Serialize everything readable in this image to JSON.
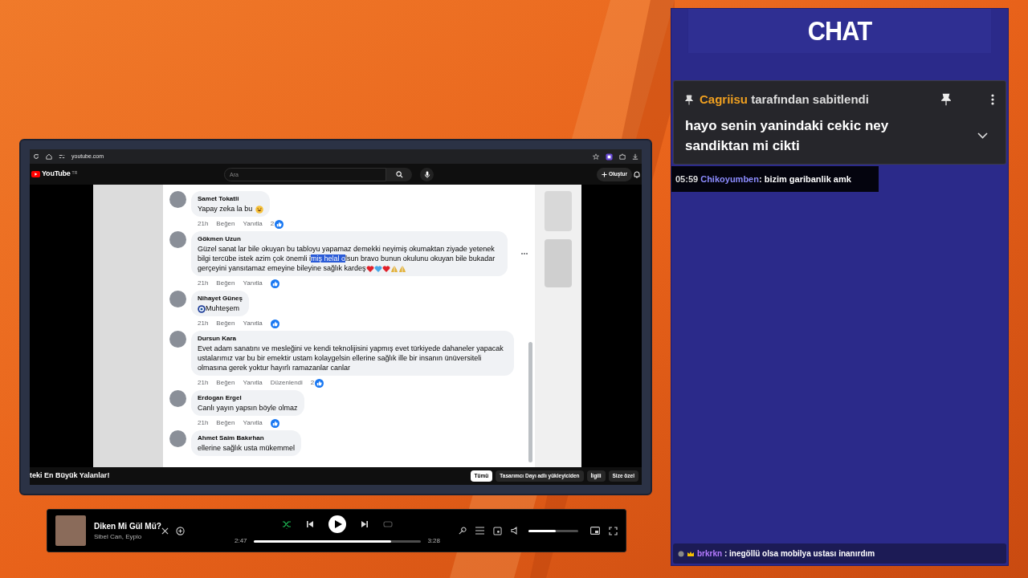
{
  "browser": {
    "url": "youtube.com",
    "youtube": {
      "logo": "YouTube",
      "region": "TR",
      "search_placeholder": "Ara",
      "create": "Oluştur"
    }
  },
  "comments": [
    {
      "author": "Samet Tokatli",
      "segments": [
        {
          "text": "Yapay zeka la bu",
          "selected": false
        }
      ],
      "emojis": [
        {
          "kind": "laugh"
        }
      ],
      "time": "21h",
      "like": "Beğen",
      "reply": "Yanıtla",
      "likes": "2"
    },
    {
      "author": "Gökmen Uzun",
      "segments": [
        {
          "text": "Güzel sanat lar bile okuyan bu tabloyu yapamaz demekki neyimiş okumaktan ziyade yetenek bilgi tercübe istek azim çok önemli i",
          "selected": false
        },
        {
          "text": "miş helal o",
          "selected": true
        },
        {
          "text": "lsun bravo bunun okulunu okuyan bile bukadar gerçeyini yansıtamaz emeyine bileyine sağlık kardeş",
          "selected": false
        }
      ],
      "emojis": [
        {
          "kind": "red-heart"
        },
        {
          "kind": "blue-heart"
        },
        {
          "kind": "red-heart"
        },
        {
          "kind": "pray"
        },
        {
          "kind": "pray"
        }
      ],
      "time": "21h",
      "like": "Beğen",
      "reply": "Yanıtla",
      "more": true
    },
    {
      "author": "Nihayet Güneş",
      "lead_emoji": {
        "kind": "nazar"
      },
      "segments": [
        {
          "text": "Muhteşem",
          "selected": false
        }
      ],
      "time": "21h",
      "like": "Beğen",
      "reply": "Yanıtla"
    },
    {
      "author": "Dursun Kara",
      "segments": [
        {
          "text": "Evet adam sanatını ve mesleğini ve kendi teknolijisini yapmış evet türkiyede dahaneler yapacak ustalarımız var bu bir emektir ustam kolaygelsin ellerine sağlık ille bir insanın ünüversiteli olmasına gerek yoktur hayırlı ramazanlar canlar",
          "selected": false
        }
      ],
      "time": "21h",
      "like": "Beğen",
      "reply": "Yanıtla",
      "edited": "Düzenlendi",
      "likes": "2"
    },
    {
      "author": "Erdogan Ergel",
      "segments": [
        {
          "text": "Canlı yayın yapsın böyle olmaz",
          "selected": false
        }
      ],
      "time": "21h",
      "like": "Beğen",
      "reply": "Yanıtla"
    },
    {
      "author": "Ahmet Saim Bakırhan",
      "segments": [
        {
          "text": "ellerine sağlık usta mükemmel",
          "selected": false
        }
      ]
    }
  ],
  "video_title": "teki En Büyük Yalanlar!",
  "chips": [
    {
      "label": "Tümü",
      "selected": true
    },
    {
      "label": "Tasarımcı Dayı adlı yükleyiciden",
      "selected": false
    },
    {
      "label": "İlgili",
      "selected": false
    },
    {
      "label": "Size özel",
      "selected": false
    }
  ],
  "player": {
    "title": "Diken Mi Gül Mü?",
    "artist": "Sibel Can, Eypio",
    "shuffle": true,
    "repeat": false,
    "elapsed": "2:47",
    "duration": "3:28",
    "level": 0.82,
    "volume": {
      "level": 0.55
    }
  },
  "chat": {
    "title": "CHAT",
    "pinned": {
      "user": "Cagriisu",
      "label": "tarafından sabitlendi",
      "message": "hayo senin yanindaki cekic ney sandiktan mi cikti"
    },
    "messages": [
      {
        "time": "05:59",
        "user": "Chikoyumben",
        "color": "#8c8cff",
        "separator": ":",
        "text": "bizim garibanlik amk"
      }
    ],
    "bottom_message": {
      "user": "brkrkn",
      "color": "#b57bff",
      "separator": ":",
      "text": "inegöllü olsa mobilya ustası inanırdım"
    }
  }
}
